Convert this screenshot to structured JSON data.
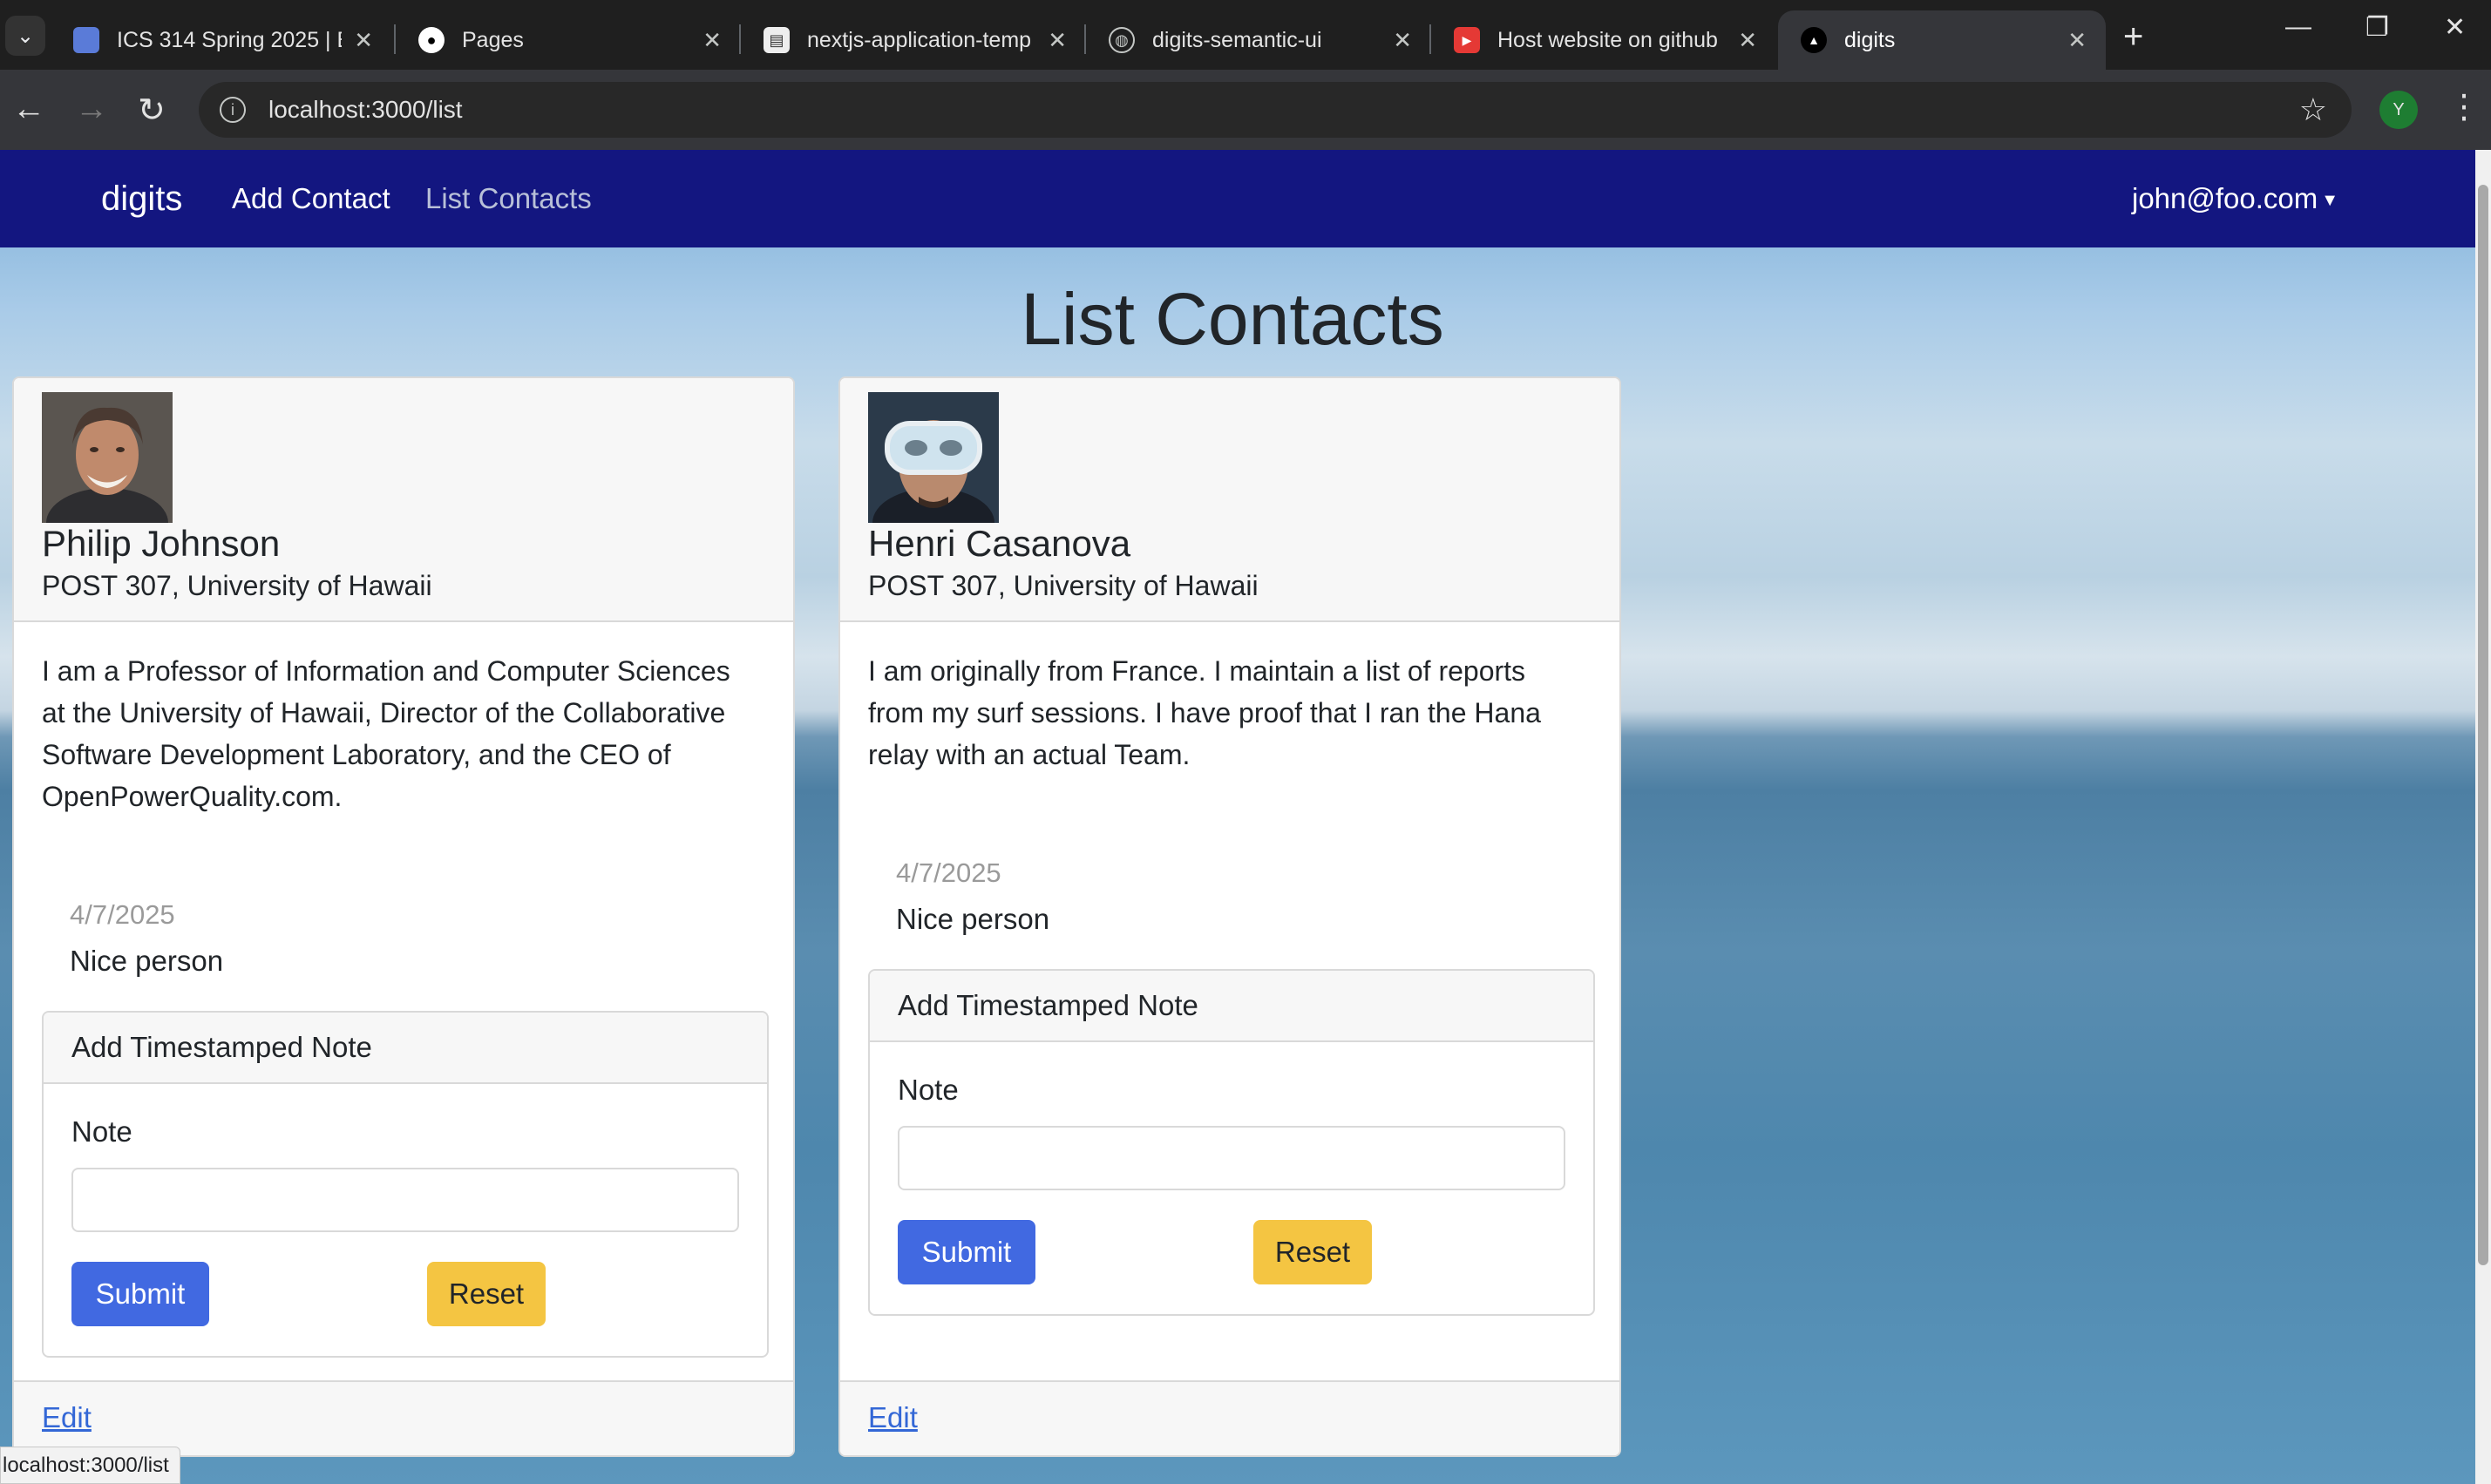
{
  "browser": {
    "tabs": [
      {
        "title": "ICS 314 Spring 2025 | ES",
        "icon": "page-icon"
      },
      {
        "title": "Pages",
        "icon": "github-icon"
      },
      {
        "title": "nextjs-application-temp",
        "icon": "document-icon"
      },
      {
        "title": "digits-semantic-ui",
        "icon": "globe-icon"
      },
      {
        "title": "Host website on github",
        "icon": "youtube-icon"
      },
      {
        "title": "digits",
        "icon": "triangle-icon"
      }
    ],
    "url": "localhost:3000/list",
    "profile_initial": "Y",
    "status_url": "localhost:3000/list"
  },
  "app": {
    "brand": "digits",
    "nav": {
      "add": "Add Contact",
      "list": "List Contacts"
    },
    "user": "john@foo.com"
  },
  "page": {
    "title": "List Contacts"
  },
  "contacts": [
    {
      "name": "Philip Johnson",
      "address": "POST 307, University of Hawaii",
      "description": "I am a Professor of Information and Computer Sciences at the University of Hawaii, Director of the Collaborative Software Development Laboratory, and the CEO of OpenPowerQuality.com.",
      "note_date": "4/7/2025",
      "note_text": "Nice person",
      "form": {
        "header": "Add Timestamped Note",
        "label": "Note",
        "submit": "Submit",
        "reset": "Reset"
      },
      "edit": "Edit"
    },
    {
      "name": "Henri Casanova",
      "address": "POST 307, University of Hawaii",
      "description": "I am originally from France. I maintain a list of reports from my surf sessions. I have proof that I ran the Hana relay with an actual Team.",
      "note_date": "4/7/2025",
      "note_text": "Nice person",
      "form": {
        "header": "Add Timestamped Note",
        "label": "Note",
        "submit": "Submit",
        "reset": "Reset"
      },
      "edit": "Edit"
    }
  ]
}
